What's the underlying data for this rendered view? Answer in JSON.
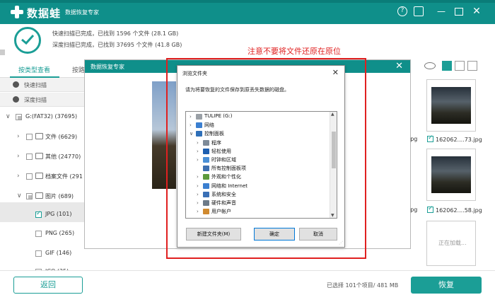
{
  "app": {
    "brand": "数据蛙",
    "subtitle": "数据恢复专家"
  },
  "status": {
    "quick_scan": "快速扫描已完成，已找到 1596 个文件 (28.1 GB)",
    "deep_scan": "深度扫描已完成，已找到 37695 个文件 (41.8 GB)"
  },
  "annotation": "注意不要将文件还原在原位",
  "left_panel": {
    "tab_type": "按类型查看",
    "tab_path": "按路",
    "scan_quick": "快速扫描",
    "scan_deep": "深度扫描",
    "drive": "G:(FAT32) (37695)",
    "categories": [
      {
        "label": "文件 (6629)"
      },
      {
        "label": "其他 (24770)"
      },
      {
        "label": "档案文件 (291"
      },
      {
        "label": "图片 (689)"
      }
    ],
    "formats": [
      {
        "label": "JPG (101)"
      },
      {
        "label": "PNG (265)"
      },
      {
        "label": "GIF (146)"
      },
      {
        "label": "ICO (35)"
      }
    ]
  },
  "thumbnails": {
    "label1": "162062....73.jpg",
    "label2": "162062....58.jpg",
    "frag1": "jpg",
    "frag2": "jpg",
    "loading": "正在加载..."
  },
  "preview_modal": {
    "title": "数据恢复专家"
  },
  "browse_dialog": {
    "title": "浏览文件夹",
    "description": "请为将要恢复的文件保存到原丢失数据的磁盘。",
    "tree": [
      {
        "label": "TULIPE (G:)",
        "icon_color": "#9aa0a6"
      },
      {
        "label": "网络",
        "icon_color": "#3b7fd0"
      },
      {
        "label": "控制面板",
        "icon_color": "#2f6fb8"
      },
      {
        "label": "程序",
        "icon_color": "#7e8a98"
      },
      {
        "label": "轻松使用",
        "icon_color": "#1e5fb0"
      },
      {
        "label": "时钟和区域",
        "icon_color": "#4a8fd6"
      },
      {
        "label": "所有控制面板项",
        "icon_color": "#3d6fb0"
      },
      {
        "label": "外观和个性化",
        "icon_color": "#5c9a3c"
      },
      {
        "label": "网络和 Internet",
        "icon_color": "#3b7fd0"
      },
      {
        "label": "系统和安全",
        "icon_color": "#3a6fb5"
      },
      {
        "label": "硬件和声音",
        "icon_color": "#6c7a88"
      },
      {
        "label": "用户帐户",
        "icon_color": "#d08a2f"
      }
    ],
    "new_folder": "新建文件夹(M)",
    "ok": "确定",
    "cancel": "取消"
  },
  "footer": {
    "back": "返回",
    "selected": "已选择 101个项目/ 481 MB",
    "recover": "恢复"
  },
  "colors": {
    "accent": "#1b9e96",
    "titlebar": "#0f8f8a",
    "warning": "#e02020"
  }
}
